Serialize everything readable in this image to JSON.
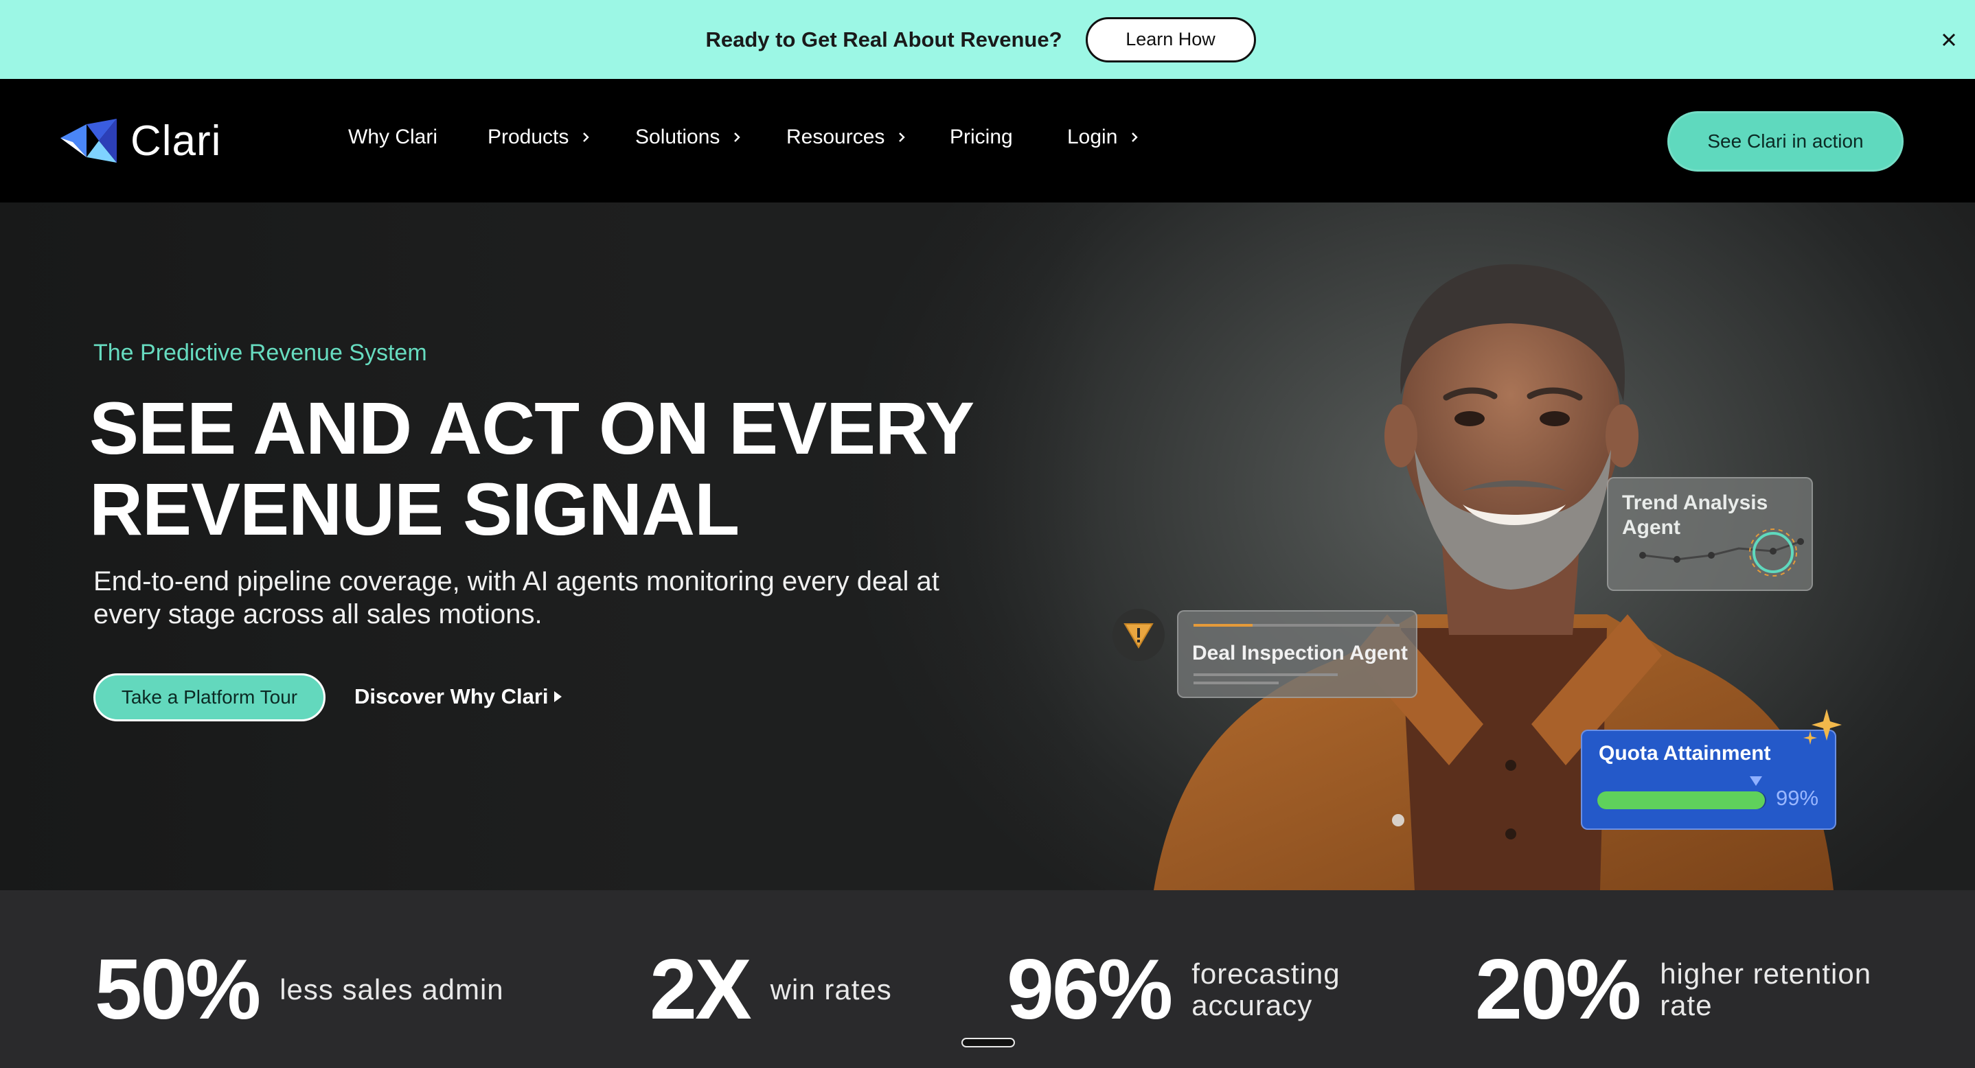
{
  "banner": {
    "text": "Ready to Get Real About Revenue?",
    "button": "Learn How",
    "close_icon": "close-icon",
    "background": "#9cf7e5"
  },
  "nav": {
    "logo_text": "Clari",
    "items": [
      {
        "label": "Why Clari",
        "has_chevron": false
      },
      {
        "label": "Products",
        "has_chevron": true
      },
      {
        "label": "Solutions",
        "has_chevron": true
      },
      {
        "label": "Resources",
        "has_chevron": true
      },
      {
        "label": "Pricing",
        "has_chevron": false
      },
      {
        "label": "Login",
        "has_chevron": true
      }
    ],
    "cta": "See Clari in action",
    "accent": "#5fd9be"
  },
  "hero": {
    "eyebrow": "The Predictive Revenue System",
    "headline_line1": "SEE AND ACT ON EVERY",
    "headline_line2": "REVENUE SIGNAL",
    "subtitle": "End-to-end pipeline coverage, with AI agents monitoring every deal at every stage across all sales motions.",
    "primary_button": "Take a Platform Tour",
    "secondary_button": "Discover Why Clari",
    "cards": {
      "trend": "Trend Analysis Agent",
      "deal": "Deal Inspection Agent",
      "quota_title": "Quota Attainment",
      "quota_value": "99%",
      "quota_fraction": 0.99
    }
  },
  "stats": [
    {
      "value": "50%",
      "label_line1": "less sales admin",
      "label_line2": ""
    },
    {
      "value": "2X",
      "label_line1": "win rates",
      "label_line2": ""
    },
    {
      "value": "96%",
      "label_line1": "forecasting",
      "label_line2": "accuracy"
    },
    {
      "value": "20%",
      "label_line1": "higher retention",
      "label_line2": "rate"
    }
  ]
}
